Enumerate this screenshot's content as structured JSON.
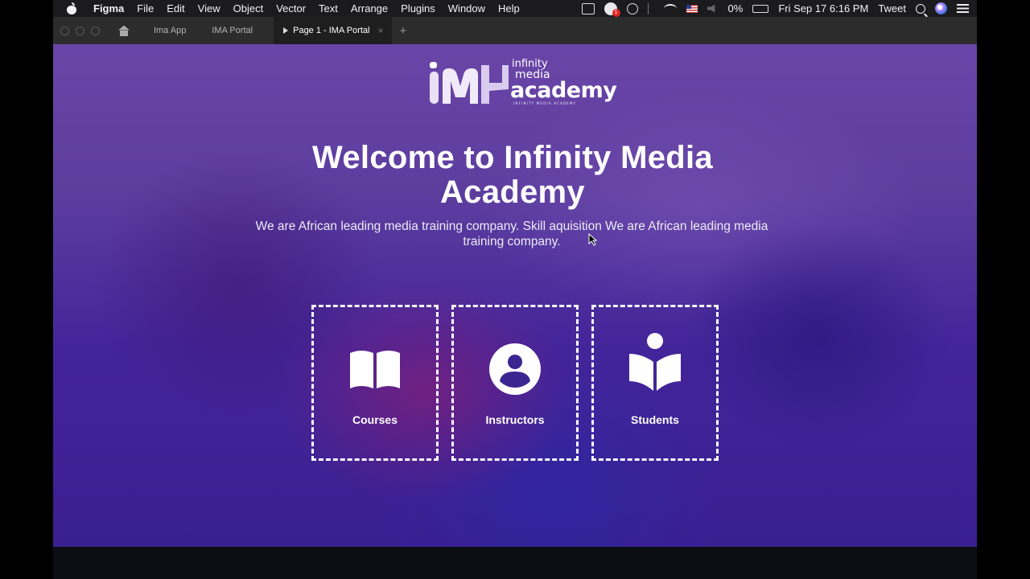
{
  "menubar": {
    "app": "Figma",
    "items": [
      "File",
      "Edit",
      "View",
      "Object",
      "Vector",
      "Text",
      "Arrange",
      "Plugins",
      "Window",
      "Help"
    ],
    "status": {
      "notification_count": "1",
      "battery": "0%",
      "clock": "Fri Sep 17  6:16 PM",
      "extra": "Tweet"
    }
  },
  "tabbar": {
    "tabs": [
      {
        "label": "Ima App"
      },
      {
        "label": "IMA Portal"
      },
      {
        "label": "Page 1 - IMA Portal",
        "active": true
      }
    ],
    "close": "×",
    "add": "+"
  },
  "page": {
    "logo": {
      "line1": "infinity",
      "line2": "media",
      "line3": "academy",
      "line4": "INFINITY MEDIA ACADEMY"
    },
    "title_line1": "Welcome to Infinity Media",
    "title_line2": "Academy",
    "subtitle": "We are African leading media training company. Skill aquisition We are African leading media training company.",
    "cards": [
      {
        "label": "Courses",
        "icon": "open-book-icon"
      },
      {
        "label": "Instructors",
        "icon": "user-circle-icon"
      },
      {
        "label": "Students",
        "icon": "reader-icon"
      }
    ]
  },
  "colors": {
    "page_bg": "#5c3d9e",
    "menubar_bg": "#1b1b1d",
    "tabbar_bg": "#2c2c2c",
    "card_border": "#ffffff"
  }
}
